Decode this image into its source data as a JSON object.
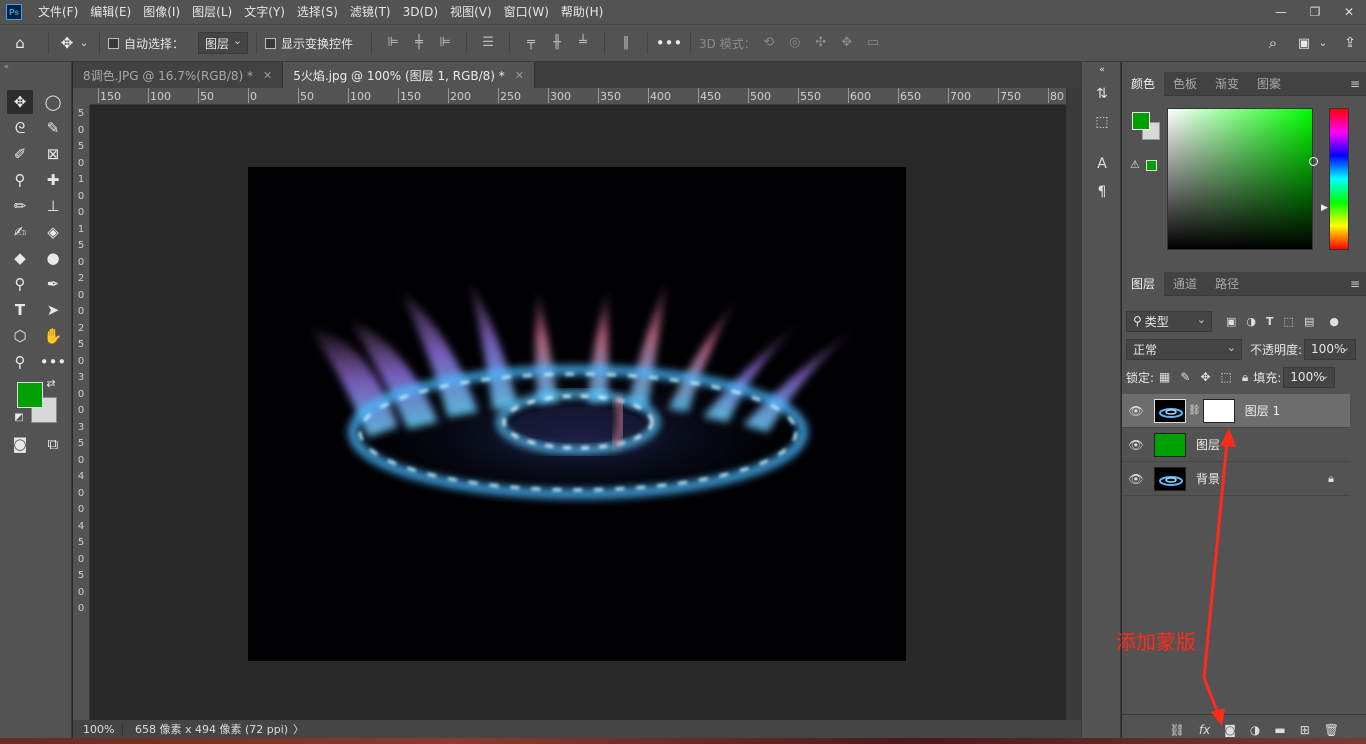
{
  "app": {
    "logo": "Ps"
  },
  "menu": [
    "文件(F)",
    "编辑(E)",
    "图像(I)",
    "图层(L)",
    "文字(Y)",
    "选择(S)",
    "滤镜(T)",
    "3D(D)",
    "视图(V)",
    "窗口(W)",
    "帮助(H)"
  ],
  "window_controls": {
    "minimize": "—",
    "restore": "❐",
    "close": "✕"
  },
  "options": {
    "auto_select_label": "自动选择：",
    "auto_select_value": "图层",
    "show_transform_label": "显示变换控件",
    "mode3d_label": "3D 模式："
  },
  "tabs": [
    {
      "label": "8调色.JPG @ 16.7%(RGB/8) *",
      "close": "✕"
    },
    {
      "label": "5火焰.jpg @ 100% (图层 1, RGB/8) *",
      "close": "✕"
    }
  ],
  "ruler_top": [
    "150",
    "100",
    "50",
    "0",
    "50",
    "100",
    "150",
    "200",
    "250",
    "300",
    "350",
    "400",
    "450",
    "500",
    "550",
    "600",
    "650",
    "700",
    "750",
    "80"
  ],
  "ruler_left": [
    "5",
    "0",
    "5",
    "0",
    "1",
    "0",
    "0",
    "1",
    "5",
    "0",
    "2",
    "0",
    "0",
    "2",
    "5",
    "0",
    "3",
    "0",
    "0",
    "3",
    "5",
    "0",
    "4",
    "0",
    "0",
    "4",
    "5",
    "0",
    "5",
    "0",
    "0"
  ],
  "status": {
    "zoom": "100%",
    "info": "658 像素 x 494 像素 (72 ppi)",
    "arrow": "〉"
  },
  "color_panel": {
    "tabs": [
      "颜色",
      "色板",
      "渐变",
      "图案"
    ],
    "foreground": "#00a000",
    "background": "#d8d8d8"
  },
  "layers_panel": {
    "tabs": [
      "图层",
      "通道",
      "路径"
    ],
    "filter_value": "类型",
    "blend_mode": "正常",
    "opacity_label": "不透明度:",
    "opacity_value": "100%",
    "lock_label": "锁定:",
    "fill_label": "填充:",
    "fill_value": "100%",
    "layers": [
      {
        "name": "图层 1",
        "selected": true,
        "has_mask": true
      },
      {
        "name": "图层",
        "selected": false,
        "color": "#00a000"
      },
      {
        "name": "背景",
        "selected": false,
        "locked": true
      }
    ]
  },
  "annotation": {
    "text": "添加蒙版",
    "color": "#ff2a1a"
  }
}
